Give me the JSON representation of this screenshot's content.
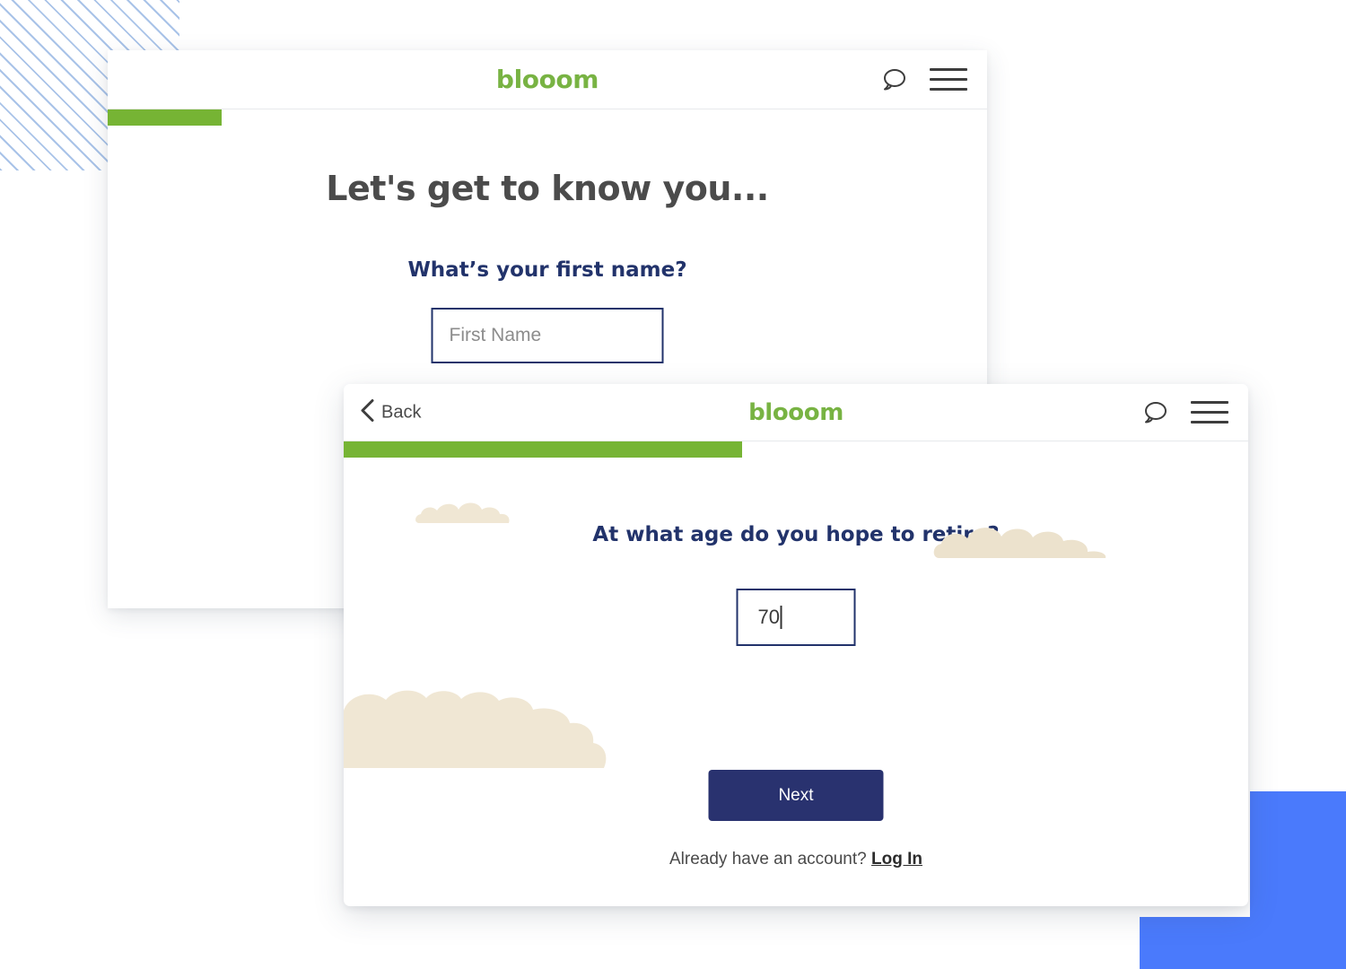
{
  "colors": {
    "brand_green": "#78b343",
    "progress_green": "#76b434",
    "navy": "#22336b",
    "button_navy": "#29326f",
    "cloud_beige": "#f0e7d4",
    "accent_blue": "#4a7afc",
    "stripe_blue": "#a9c3e8"
  },
  "card_back": {
    "logo": "blooom",
    "chat_icon": "speech-bubble-icon",
    "menu_icon": "hamburger-menu-icon",
    "progress_percent": 13,
    "title": "Let's get to know you...",
    "question": "What’s your first name?",
    "first_name_value": "",
    "first_name_placeholder": "First Name"
  },
  "card_front": {
    "back_label": "Back",
    "back_icon": "chevron-left-icon",
    "logo": "blooom",
    "chat_icon": "speech-bubble-icon",
    "menu_icon": "hamburger-menu-icon",
    "progress_percent": 44,
    "question": "At what age do you hope to retire?",
    "retirement_age_value": "70",
    "next_label": "Next",
    "footer_text": "Already have an account?",
    "login_label": "Log In"
  }
}
